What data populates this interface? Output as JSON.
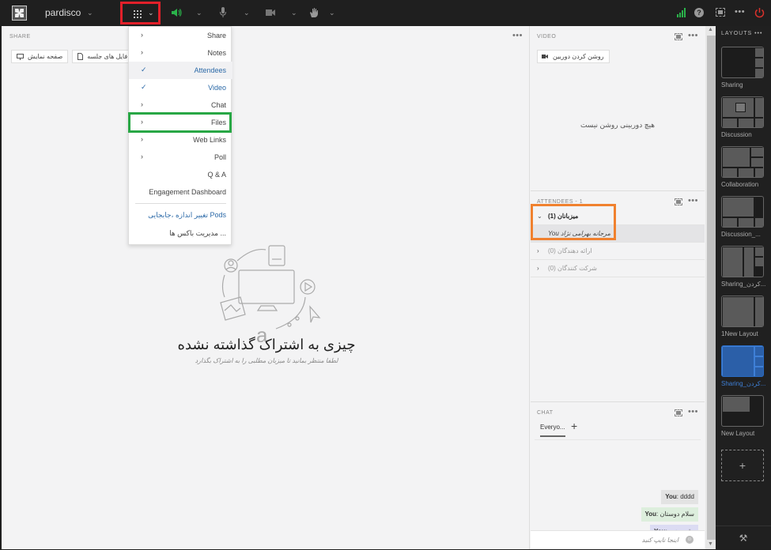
{
  "topbar": {
    "room_name": "pardisco",
    "icons": [
      "apps-grid-icon",
      "speaker-icon",
      "microphone-icon",
      "camera-icon",
      "raise-hand-icon",
      "signal-icon",
      "help-icon",
      "fullscreen-icon",
      "more-icon",
      "power-icon"
    ]
  },
  "share": {
    "title": "SHARE",
    "toolbar": [
      {
        "label": "صفحه نمایش",
        "icon": "monitor-icon"
      },
      {
        "label": "فایل های جلسه",
        "icon": "file-icon"
      }
    ],
    "empty_title": "چیزی به اشتراک گذاشته نشده",
    "empty_subtitle": "لطفا منتظر بمانید تا میزبان مطلبی را به اشتراک بگذارد"
  },
  "pods_menu": {
    "items": [
      {
        "label": "Share",
        "mark": "›",
        "checked": false
      },
      {
        "label": "Notes",
        "mark": "›",
        "checked": false
      },
      {
        "label": "Attendees",
        "mark": "✓",
        "checked": true
      },
      {
        "label": "Video",
        "mark": "✓",
        "checked": true
      },
      {
        "label": "Chat",
        "mark": "›",
        "checked": false
      },
      {
        "label": "Files",
        "mark": "›",
        "checked": false
      },
      {
        "label": "Web Links",
        "mark": "›",
        "checked": false
      },
      {
        "label": "Poll",
        "mark": "›",
        "checked": false
      },
      {
        "label": "Q & A",
        "mark": "",
        "checked": false
      },
      {
        "label": "Engagement Dashboard",
        "mark": "",
        "checked": false
      },
      {
        "label": "تغییر اندازه ،جابجایی Pods",
        "mark": "",
        "checked": false
      },
      {
        "label": "مدیریت باکس ها ...",
        "mark": "",
        "checked": false
      }
    ]
  },
  "video": {
    "title": "VIDEO",
    "camera_button": "روشن کردن دوربین",
    "no_camera": "هیچ دوربینی روشن نیست"
  },
  "attendees": {
    "title": "ATTENDEES - 1",
    "groups": [
      {
        "label": "میزبانان (1)",
        "open": true,
        "arrow": "⌄"
      },
      {
        "label": "ارائه دهندگان (0)",
        "open": false,
        "arrow": "›"
      },
      {
        "label": "شرکت کنندگان (0)",
        "open": false,
        "arrow": "›"
      }
    ],
    "user": {
      "you": "You",
      "name": "مرجانه بهرامی نژاد"
    }
  },
  "chat": {
    "title": "CHAT",
    "tab": "Everyo...",
    "add": "+",
    "messages": [
      {
        "sender": "You",
        "text": ": dddd",
        "color": "#e3e3e3"
      },
      {
        "sender": "You",
        "text": ": سلام دوستان",
        "color": "#ddeedd"
      },
      {
        "sender": "You",
        "text": ": وقت بخیر",
        "color": "#dcdcf3"
      }
    ],
    "placeholder": "اینجا تایپ کنید"
  },
  "layouts": {
    "title": "LAYOUTS •••",
    "items": [
      {
        "name": "Sharing",
        "active": false
      },
      {
        "name": "Discussion",
        "active": false
      },
      {
        "name": "Collaboration",
        "active": false
      },
      {
        "name": "Discussion_...",
        "active": false
      },
      {
        "name": "Sharing_کردن...",
        "active": false
      },
      {
        "name": "1New Layout",
        "active": false
      },
      {
        "name": "Sharing_کردن...",
        "active": true
      },
      {
        "name": "New Layout",
        "active": false
      }
    ],
    "add": "+"
  },
  "colors": {
    "highlight_apps": "#e2202a",
    "highlight_files": "#28a745",
    "highlight_attendees": "#f0812f",
    "accent_blue": "#2c6aa8"
  }
}
